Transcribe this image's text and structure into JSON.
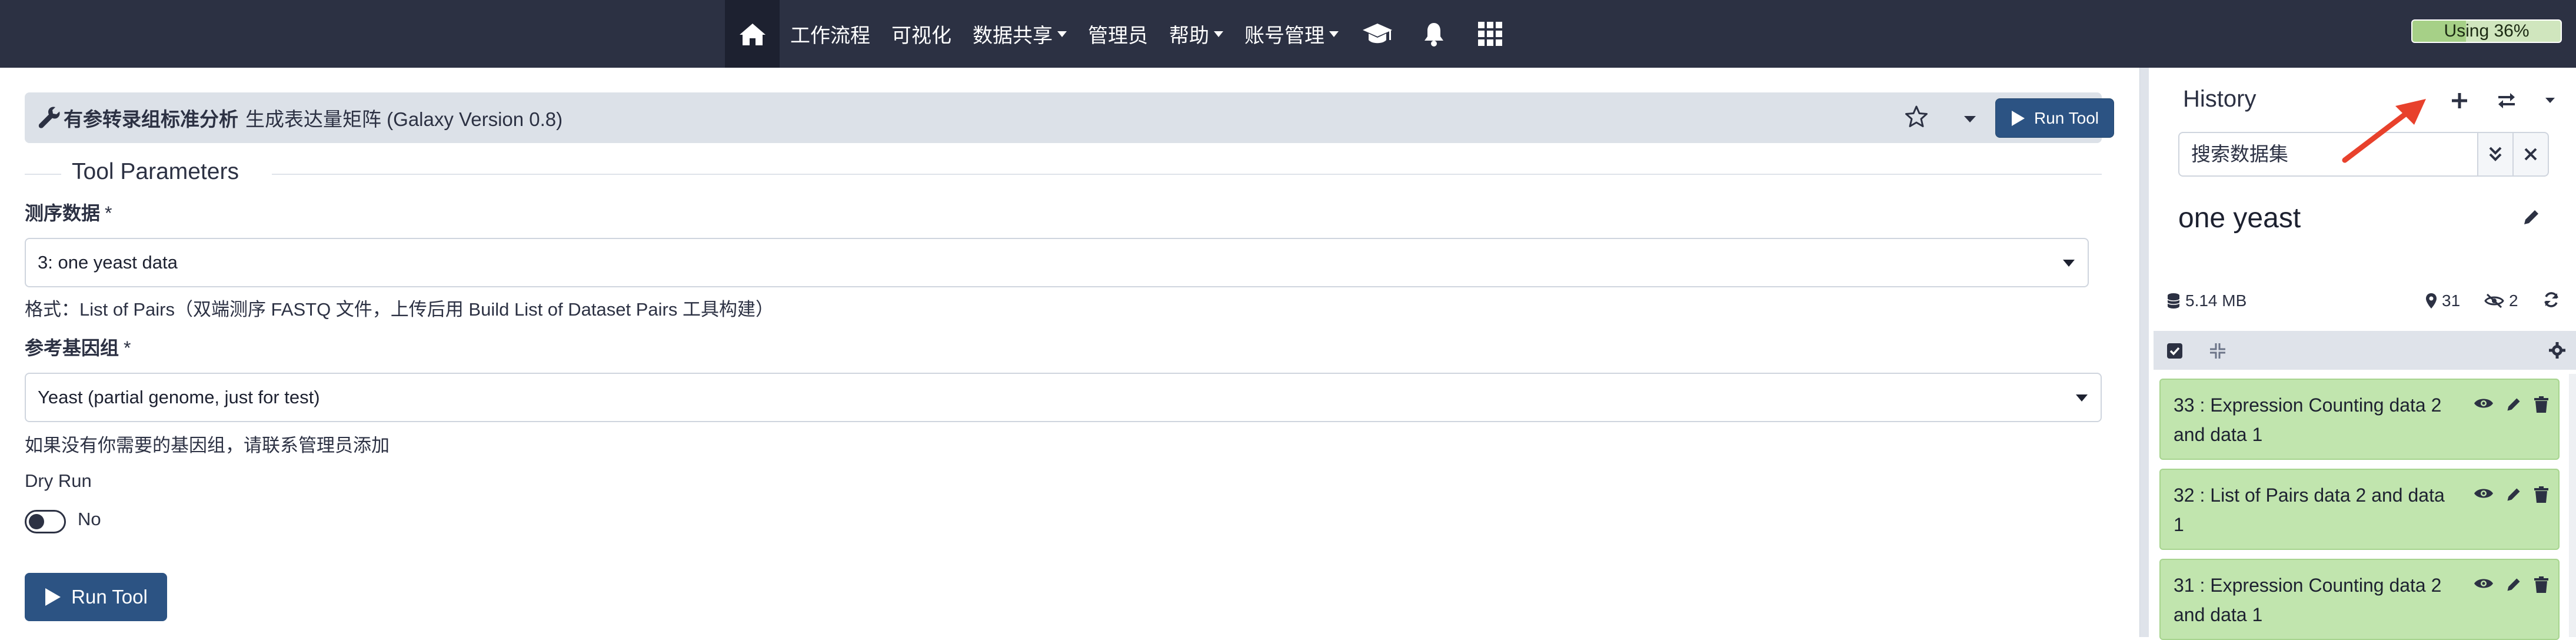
{
  "navbar": {
    "home_icon": "home-icon",
    "items": [
      {
        "label": "工作流程",
        "dropdown": false
      },
      {
        "label": "可视化",
        "dropdown": false
      },
      {
        "label": "数据共享",
        "dropdown": true
      },
      {
        "label": "管理员",
        "dropdown": false
      },
      {
        "label": "帮助",
        "dropdown": true
      },
      {
        "label": "账号管理",
        "dropdown": true
      }
    ],
    "icons": [
      "graduation-cap-icon",
      "bell-icon",
      "grid-icon"
    ],
    "quota": {
      "label": "Using 36%",
      "fraction": 0.36
    }
  },
  "tool": {
    "title_bold": "有参转录组标准分析",
    "title_rest": "生成表达量矩阵 (Galaxy Version 0.8)",
    "run_button_label": "Run Tool",
    "section_title": "Tool Parameters",
    "params": {
      "seq_data": {
        "label": "测序数据",
        "required_mark": "*",
        "value": "3: one yeast data",
        "help": "格式：List of Pairs（双端测序 FASTQ 文件，上传后用 Build List of Dataset Pairs 工具构建）"
      },
      "ref_genome": {
        "label": "参考基因组",
        "required_mark": "*",
        "value": "Yeast (partial genome, just for test)",
        "help": "如果没有你需要的基因组，请联系管理员添加"
      },
      "dry_run": {
        "label": "Dry Run",
        "value": "No"
      }
    },
    "run_button_big_label": "Run Tool"
  },
  "history": {
    "title": "History",
    "search_placeholder": "搜索数据集",
    "name": "one yeast",
    "size": "5.14 MB",
    "count_shown": "31",
    "count_hidden": "2",
    "items": [
      {
        "title": "33 : Expression Counting data 2 and data 1"
      },
      {
        "title": "32 : List of Pairs data 2 and data 1"
      },
      {
        "title": "31 : Expression Counting data 2 and data 1"
      }
    ],
    "colors": {
      "ok_bg": "#c1e5ae",
      "annotation_arrow": "#e8412c"
    }
  }
}
